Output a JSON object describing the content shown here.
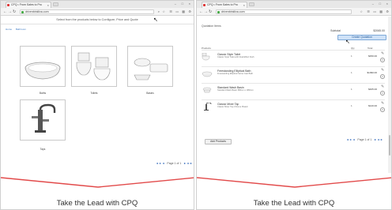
{
  "left": {
    "tab_title": "CPQ • From Sales to Pro",
    "url": "drivenbinkliva.com",
    "subheader": "Select from the products below to Configure, Price and Quote",
    "breadcrumb": [
      "Home",
      "Bathroom"
    ],
    "categories": [
      {
        "label": "Baths"
      },
      {
        "label": "Toilets"
      },
      {
        "label": "Basins"
      },
      {
        "label": "Taps"
      }
    ],
    "pager": {
      "prev2": "◄◄",
      "prev": "◄",
      "text": "Page 1 of 1",
      "next": "►",
      "next2": "►►"
    }
  },
  "right": {
    "tab_title": "CPQ • From Sales to Pro",
    "url": "drivenbinkliva.com",
    "section_title": "Quotation Items",
    "subtotal_label": "Subtotal",
    "subtotal_value": "$2065.00",
    "create_button": "Create Quotation",
    "columns": {
      "products": "Products",
      "qty": "Qty",
      "total": "Total"
    },
    "products": [
      {
        "name": "Classic Style Toilet",
        "desc": "Classic Style Toilet with Dual Effect flush",
        "qty": "1",
        "total": "$450.00"
      },
      {
        "name": "Freestanding Elliptical Bath",
        "desc": "Freestanding Elliptical Stone Cast Bath",
        "qty": "1",
        "total": "$1090.00"
      },
      {
        "name": "Standard Wash Basin",
        "desc": "Standard Wash Basin 580mm x 380mm",
        "qty": "1",
        "total": "$405.00"
      },
      {
        "name": "Classic Mixer Tap",
        "desc": "Classic Mixer Tap Chrome Plated",
        "qty": "1",
        "total": "$120.00"
      }
    ],
    "add_button": "Add Products",
    "pager": {
      "prev2": "◄◄",
      "prev": "◄",
      "text": "Page 1 of 1",
      "next": "►",
      "next2": "►►"
    }
  },
  "footer": {
    "tagline": "Take the Lead with CPQ",
    "accent": "#e24a4a"
  },
  "icons": {
    "back": "back-arrow-icon",
    "forward": "forward-arrow-icon",
    "reload": "reload-icon",
    "star": "star-icon",
    "menu": "menu-icon"
  }
}
